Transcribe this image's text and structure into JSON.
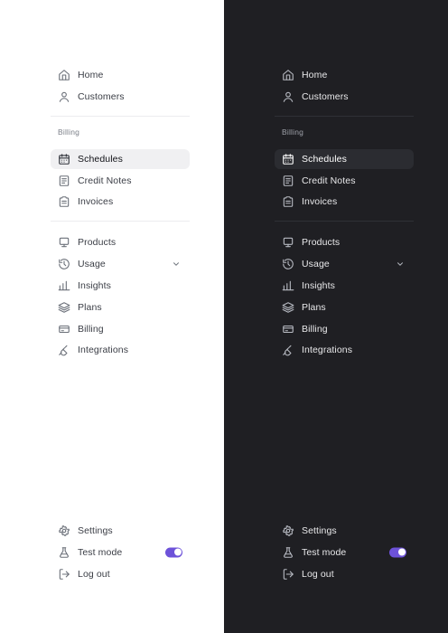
{
  "light": {
    "items_top": [
      {
        "label": "Home",
        "icon": "home-icon"
      },
      {
        "label": "Customers",
        "icon": "user-icon"
      }
    ],
    "billing_title": "Billing",
    "items_billing": [
      {
        "label": "Schedules",
        "icon": "calendar-icon",
        "active": true
      },
      {
        "label": "Credit Notes",
        "icon": "credit-note-icon"
      },
      {
        "label": "Invoices",
        "icon": "invoice-icon"
      }
    ],
    "items_mid": [
      {
        "label": "Products",
        "icon": "product-icon"
      },
      {
        "label": "Usage",
        "icon": "usage-icon",
        "has_chevron": true
      },
      {
        "label": "Insights",
        "icon": "bar-chart-icon"
      },
      {
        "label": "Plans",
        "icon": "layers-icon"
      },
      {
        "label": "Billing",
        "icon": "credit-card-icon"
      },
      {
        "label": "Integrations",
        "icon": "plug-icon"
      }
    ],
    "items_bottom": [
      {
        "label": "Settings",
        "icon": "gear-icon"
      },
      {
        "label": "Test mode",
        "icon": "flask-icon",
        "toggle_on": true
      },
      {
        "label": "Log out",
        "icon": "logout-icon"
      }
    ]
  },
  "dark": {
    "items_top": [
      {
        "label": "Home",
        "icon": "home-icon"
      },
      {
        "label": "Customers",
        "icon": "user-icon"
      }
    ],
    "billing_title": "Billing",
    "items_billing": [
      {
        "label": "Schedules",
        "icon": "calendar-icon",
        "active": true
      },
      {
        "label": "Credit Notes",
        "icon": "credit-note-icon"
      },
      {
        "label": "Invoices",
        "icon": "invoice-icon"
      }
    ],
    "items_mid": [
      {
        "label": "Products",
        "icon": "product-icon"
      },
      {
        "label": "Usage",
        "icon": "usage-icon",
        "has_chevron": true
      },
      {
        "label": "Insights",
        "icon": "bar-chart-icon"
      },
      {
        "label": "Plans",
        "icon": "layers-icon"
      },
      {
        "label": "Billing",
        "icon": "credit-card-icon"
      },
      {
        "label": "Integrations",
        "icon": "plug-icon"
      }
    ],
    "items_bottom": [
      {
        "label": "Settings",
        "icon": "gear-icon"
      },
      {
        "label": "Test mode",
        "icon": "flask-icon",
        "toggle_on": true
      },
      {
        "label": "Log out",
        "icon": "logout-icon"
      }
    ]
  },
  "colors": {
    "light_bg": "#ffffff",
    "dark_bg": "#1f1f23",
    "toggle_accent": "#6d52d9"
  }
}
